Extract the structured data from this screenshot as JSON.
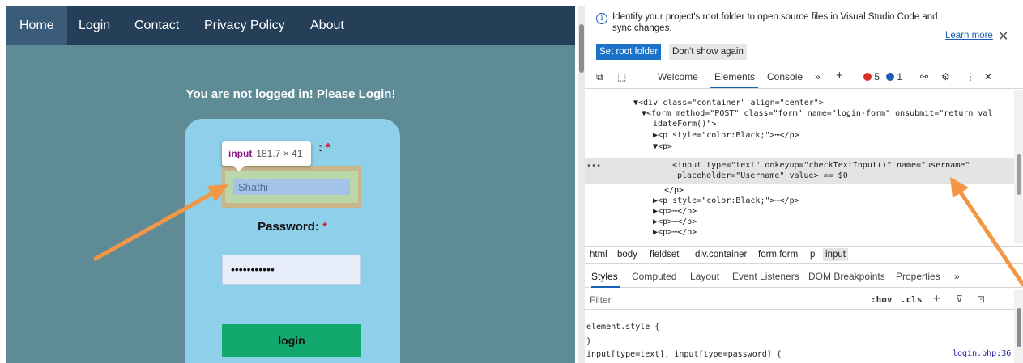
{
  "nav": {
    "items": [
      "Home",
      "Login",
      "Contact",
      "Privacy Policy",
      "About"
    ],
    "active": "Home"
  },
  "page": {
    "notice": "You are not logged in! Please Login!",
    "username_label_tail": ":",
    "required_mark": "*",
    "username_value": "Shathi",
    "password_label": "Password:",
    "password_value": "•••••••••••",
    "login_button": "login"
  },
  "inspect_tooltip": {
    "tag": "input",
    "size": "181.7 × 41"
  },
  "devtools": {
    "infobar": {
      "message": "Identify your project's root folder to open source files in Visual Studio Code and sync changes.",
      "learn_more": "Learn more",
      "set_root": "Set root folder",
      "dont_show": "Don't show again"
    },
    "tabs": {
      "welcome": "Welcome",
      "elements": "Elements",
      "console": "Console",
      "errors": "5",
      "messages": "1"
    },
    "dom_lines": {
      "l1": "▼<div class=\"container\" align=\"center\">",
      "l2a": "▼<form method=\"POST\" class=\"form\" name=\"login-form\" onsubmit=\"return val",
      "l2b": "idateForm()\">",
      "l3": "▶<p style=\"color:Black;\">⋯</p>",
      "l4": "▼<p>",
      "l5a": "<input type=\"text\" onkeyup=\"checkTextInput()\" name=\"username\"",
      "l5b": "placeholder=\"Username\" value> == $0",
      "l6": "</p>",
      "l7": "▶<p style=\"color:Black;\">⋯</p>",
      "l8": "▶<p>⋯</p>",
      "l9": "▶<p>⋯</p>",
      "l10": "▶<p>⋯</p>"
    },
    "breadcrumbs": [
      "html",
      "body",
      "fieldset",
      "div.container",
      "form.form",
      "p",
      "input"
    ],
    "subtabs": [
      "Styles",
      "Computed",
      "Layout",
      "Event Listeners",
      "DOM Breakpoints",
      "Properties"
    ],
    "filter_placeholder": "Filter",
    "hov": ":hov",
    "cls": ".cls",
    "styles_lines": {
      "s1": "element.style {",
      "s2": "}",
      "s3": "input[type=text], input[type=password] {"
    },
    "source_link": "login.php:36"
  },
  "colors": {
    "page_bg": "#5f8b96",
    "nav_bg": "#243f57",
    "card_bg": "#8ecfe9",
    "login_green": "#13a86e",
    "arrow_orange": "#f39646",
    "devtools_blue": "#1a73c8"
  }
}
